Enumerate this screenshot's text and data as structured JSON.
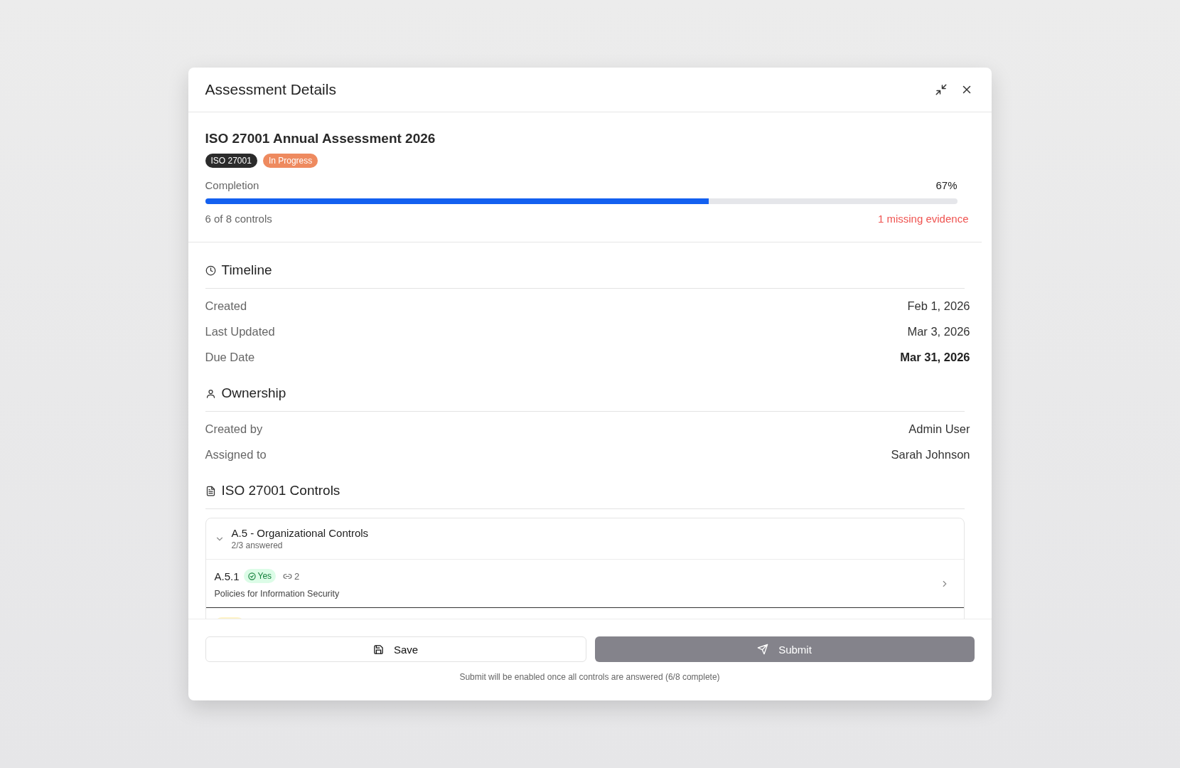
{
  "dialog": {
    "title": "Assessment Details"
  },
  "assessment": {
    "name": "ISO 27001 Annual Assessment 2026",
    "badges": [
      {
        "label": "ISO 27001",
        "kind": "framework"
      },
      {
        "label": "In Progress",
        "kind": "status"
      }
    ],
    "completion_label": "Completion",
    "completion_value": "67%",
    "level": 0.67,
    "controls_count": "6 of 8 controls",
    "missing": "1 missing evidence"
  },
  "sections": [
    {
      "title": "Timeline",
      "kind": "clock",
      "rows": [
        {
          "label": "Created",
          "value": "Feb 1, 2026",
          "emphasis": false
        },
        {
          "label": "Last Updated",
          "value": "Mar 3, 2026",
          "emphasis": false
        },
        {
          "label": "Due Date",
          "value": "Mar 31, 2026",
          "emphasis": true
        }
      ]
    },
    {
      "title": "Ownership",
      "kind": "person",
      "rows": [
        {
          "label": "Created by",
          "value": "Admin User",
          "emphasis": false
        },
        {
          "label": "Assigned to",
          "value": "Sarah Johnson",
          "emphasis": false
        }
      ]
    }
  ],
  "controls": {
    "title": "ISO 27001 Controls",
    "groups": [
      {
        "title": "A.5 - Organizational Controls",
        "answered": "2/3 answered",
        "expanded": true,
        "items": [
          {
            "code": "A.5.1",
            "answer": "Yes",
            "kind": "answered",
            "links": "2",
            "name": "Policies for Information Security"
          },
          {
            "kind": "pending"
          }
        ]
      }
    ]
  },
  "footer": {
    "save": "Save",
    "submit": "Submit",
    "submit_disabled": true,
    "note": "Submit will be enabled once all controls are answered (6/8 complete)"
  }
}
